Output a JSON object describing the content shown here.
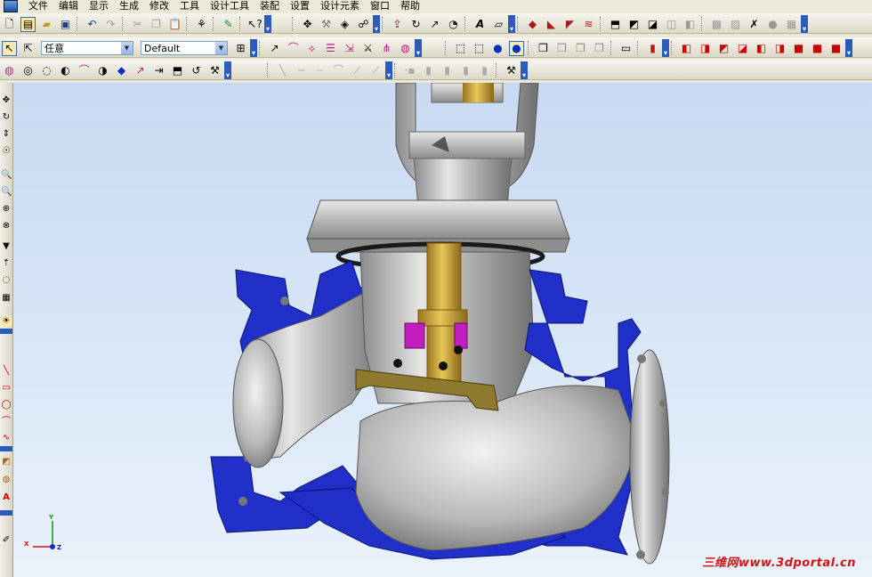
{
  "menu": [
    "文件",
    "编辑",
    "显示",
    "生成",
    "修改",
    "工具",
    "设计工具",
    "装配",
    "设置",
    "设计元素",
    "窗口",
    "帮助"
  ],
  "toolbar2": {
    "filter_value": "任意",
    "style_value": "Default"
  },
  "triad": {
    "x": "X",
    "y": "Y",
    "z": "Z"
  },
  "watermark": "三维网www.3dportal.cn",
  "colors": {
    "section_fill": "#1f2fc8",
    "stem": "#c8a032",
    "disc": "#8e7a2e",
    "seal": "#c21ec0",
    "background": "#d9e7f7"
  }
}
